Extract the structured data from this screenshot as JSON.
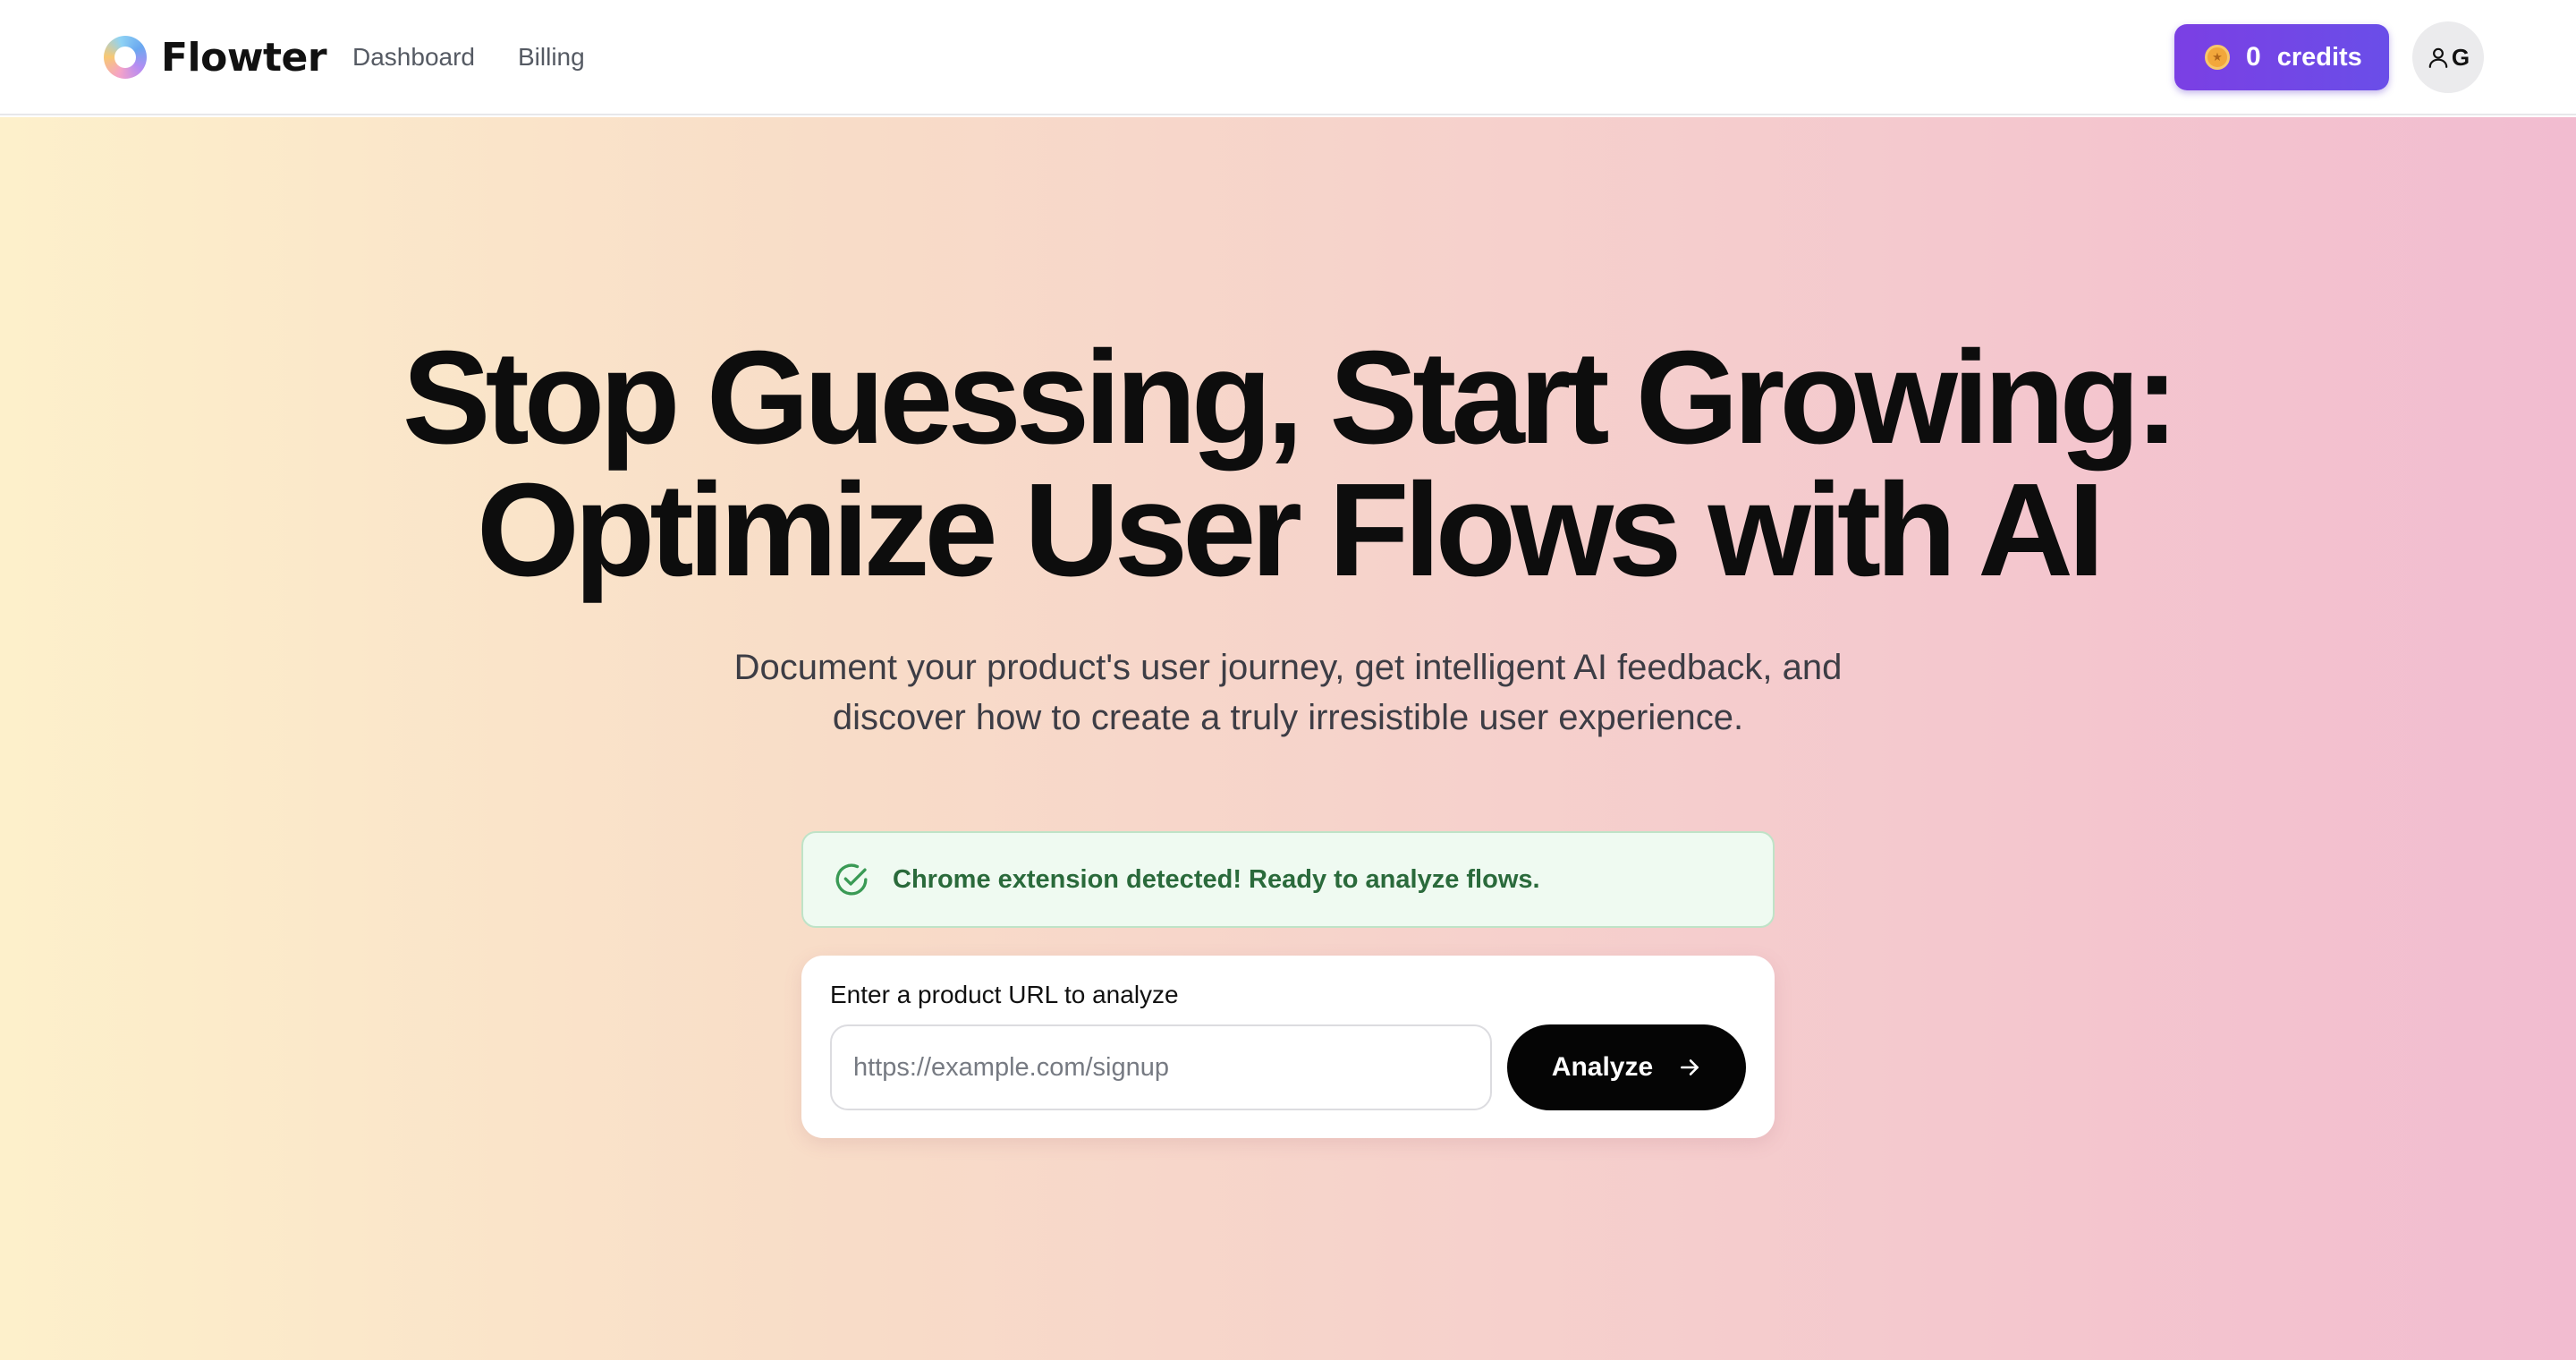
{
  "brand": {
    "name": "Flowter",
    "logo_icon": "ring-logo-icon"
  },
  "nav": {
    "items": [
      {
        "label": "Dashboard"
      },
      {
        "label": "Billing"
      }
    ]
  },
  "credits": {
    "count": "0",
    "label": "credits",
    "icon": "coin-icon",
    "accent": "#7b3fe4"
  },
  "avatar": {
    "icon": "user-icon",
    "initial": "G"
  },
  "hero": {
    "title_line1": "Stop Guessing, Start Growing:",
    "title_line2": "Optimize User Flows with AI",
    "subtitle_line1": "Document your product's user journey, get intelligent AI feedback, and",
    "subtitle_line2": "discover how to create a truly irresistible user experience."
  },
  "extension_banner": {
    "icon": "check-circle-icon",
    "text": "Chrome extension detected! Ready to analyze flows.",
    "color": "#2a6a3b"
  },
  "analyze_form": {
    "label": "Enter a product URL to analyze",
    "input_value": "",
    "placeholder": "https://example.com/signup",
    "button_label": "Analyze",
    "button_icon": "arrow-right-icon"
  }
}
